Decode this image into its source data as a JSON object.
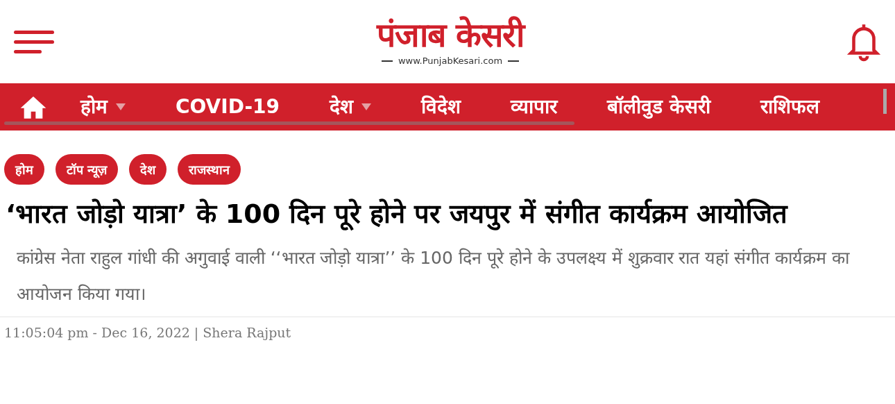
{
  "header": {
    "logo": "पंजाब केसरी",
    "site_url": "www.PunjabKesari.com"
  },
  "nav": {
    "items": [
      {
        "label": "होम",
        "has_dropdown": true
      },
      {
        "label": "COVID-19",
        "has_dropdown": false
      },
      {
        "label": "देश",
        "has_dropdown": true
      },
      {
        "label": "विदेश",
        "has_dropdown": false
      },
      {
        "label": "व्यापार",
        "has_dropdown": false
      },
      {
        "label": "बॉलीवुड केसरी",
        "has_dropdown": false
      },
      {
        "label": "राशिफल",
        "has_dropdown": false
      }
    ]
  },
  "breadcrumbs": [
    "होम",
    "टॉप न्यूज़",
    "देश",
    "राजस्थान"
  ],
  "article": {
    "headline": "‘भारत जोड़ो यात्रा’ के 100 दिन पूरे होने पर जयपुर में संगीत कार्यक्रम आयोजित",
    "summary": "कांग्रेस नेता राहुल गांधी की अगुवाई वाली ‘‘भारत जोड़ो यात्रा’’ के 100 दिन पूरे होने के उपलक्ष्य में शुक्रवार रात यहां संगीत कार्यक्रम का आयोजन किया गया।",
    "byline": "11:05:04 pm - Dec 16, 2022 | Shera Rajput"
  }
}
